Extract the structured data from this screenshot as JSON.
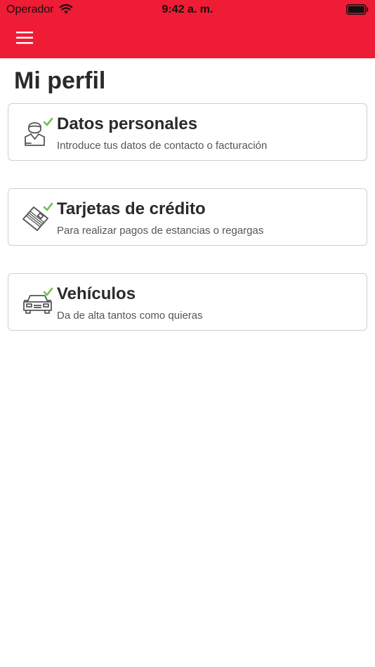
{
  "status_bar": {
    "carrier": "Operador",
    "time": "9:42 a. m."
  },
  "header": {
    "menu_icon": "hamburger-menu-icon",
    "background": "#ee1c34"
  },
  "page": {
    "title": "Mi perfil"
  },
  "cards": [
    {
      "title": "Datos personales",
      "subtitle": "Introduce tus datos de contacto o facturación",
      "icon": "person-check-icon",
      "completed": true
    },
    {
      "title": "Tarjetas de crédito",
      "subtitle": "Para realizar pagos de estancias o regargas",
      "icon": "credit-card-check-icon",
      "completed": true
    },
    {
      "title": "Vehículos",
      "subtitle": "Da de alta tantos como quieras",
      "icon": "car-check-icon",
      "completed": true
    }
  ],
  "colors": {
    "accent": "#ee1c34",
    "check": "#6cc04a",
    "icon_stroke": "#555555"
  }
}
